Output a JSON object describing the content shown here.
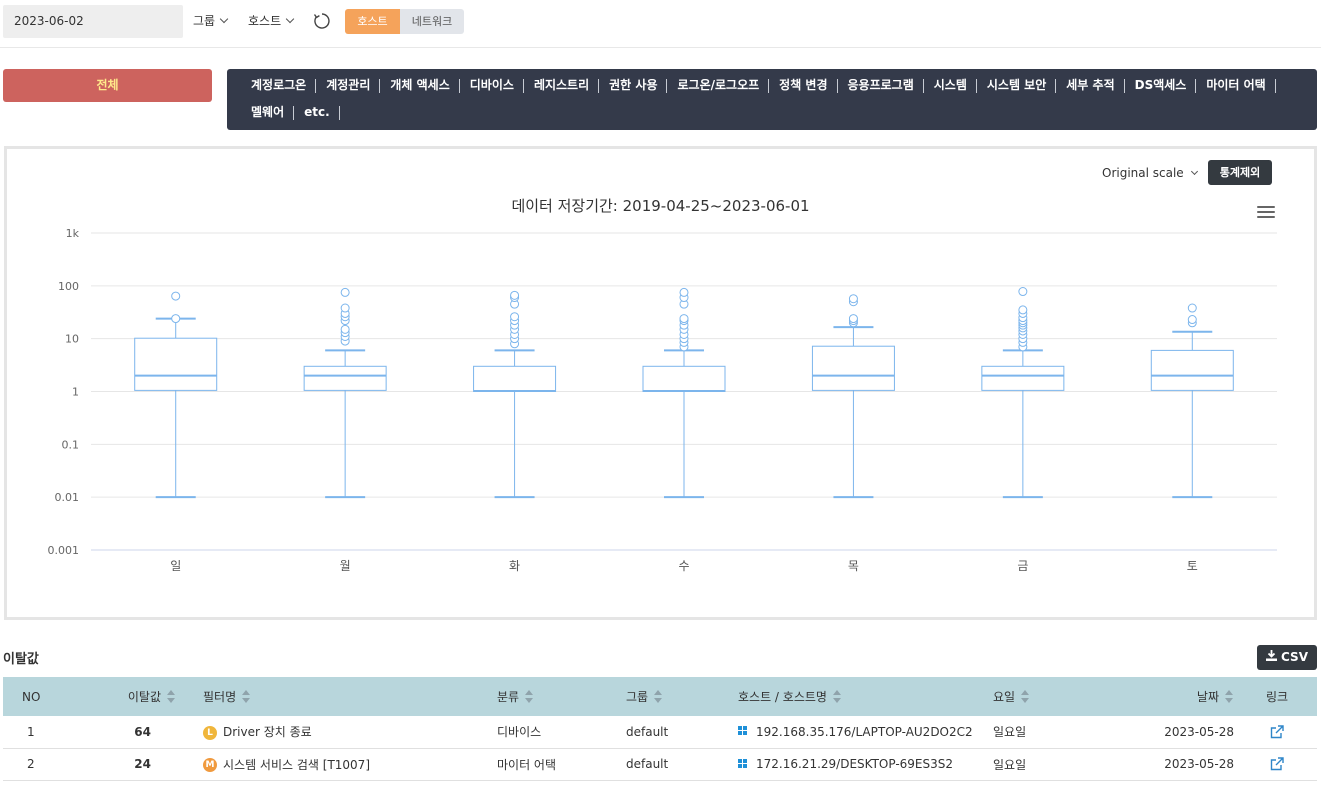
{
  "toolbar": {
    "date": "2023-06-02",
    "group_label": "그룹",
    "host_label": "호스트",
    "seg_host": "호스트",
    "seg_network": "네트워크"
  },
  "filters": {
    "all_label": "전체",
    "categories": [
      "계정로그온",
      "계정관리",
      "개체 액세스",
      "디바이스",
      "레지스트리",
      "권한 사용",
      "로그온/로그오프",
      "정책 변경",
      "응용프로그램",
      "시스템",
      "시스템 보안",
      "세부 추적",
      "DS액세스",
      "마이터 어택",
      "멜웨어",
      "etc."
    ]
  },
  "chart_controls": {
    "scale_label": "Original scale",
    "exclude_label": "통계제외",
    "title": "데이터 저장기간: 2019-04-25~2023-06-01"
  },
  "chart_data": {
    "type": "boxplot",
    "y_scale": "log",
    "ylim": [
      0.001,
      1000
    ],
    "y_ticks": [
      "0.001",
      "0.01",
      "0.1",
      "1",
      "10",
      "100",
      "1k"
    ],
    "categories": [
      "일",
      "월",
      "화",
      "수",
      "목",
      "금",
      "토"
    ],
    "boxes": [
      {
        "min": 0.01,
        "q1": 1.05,
        "median": 2,
        "q3": 10.2,
        "max": 24,
        "outliers": [
          24,
          64
        ]
      },
      {
        "min": 0.01,
        "q1": 1.05,
        "median": 2,
        "q3": 3,
        "max": 6,
        "outliers": [
          9,
          11,
          13,
          15,
          22,
          26,
          30,
          38,
          75
        ]
      },
      {
        "min": 0.01,
        "q1": 1.0,
        "median": 1.02,
        "q3": 3,
        "max": 6,
        "outliers": [
          8,
          10,
          12,
          15,
          18,
          22,
          26,
          45,
          60,
          66
        ]
      },
      {
        "min": 0.01,
        "q1": 1.0,
        "median": 1.02,
        "q3": 3,
        "max": 6,
        "outliers": [
          7,
          8.5,
          10,
          12,
          15,
          18,
          22,
          24,
          45,
          60,
          75
        ]
      },
      {
        "min": 0.01,
        "q1": 1.05,
        "median": 2,
        "q3": 7.2,
        "max": 16.5,
        "outliers": [
          20,
          22,
          24,
          50,
          57
        ]
      },
      {
        "min": 0.01,
        "q1": 1.05,
        "median": 2,
        "q3": 3,
        "max": 6,
        "outliers": [
          7,
          8.5,
          10,
          12,
          14,
          16,
          18,
          20,
          22,
          25,
          30,
          35,
          78
        ]
      },
      {
        "min": 0.01,
        "q1": 1.05,
        "median": 2,
        "q3": 6,
        "max": 13.5,
        "outliers": [
          20,
          23,
          38
        ]
      }
    ]
  },
  "outliers": {
    "title": "이탈값",
    "csv_label": "CSV",
    "headers": {
      "no": "NO",
      "value": "이탈값",
      "filter": "필터명",
      "category": "분류",
      "group": "그룹",
      "host": "호스트 / 호스트명",
      "day": "요일",
      "date": "날짜",
      "link": "링크"
    },
    "rows": [
      {
        "no": "1",
        "value": "64",
        "level": "L",
        "level_color": "#f0b63b",
        "filter": "Driver 장치 종료",
        "category": "디바이스",
        "group": "default",
        "host": "192.168.35.176/LAPTOP-AU2DO2C2",
        "day": "일요일",
        "date": "2023-05-28"
      },
      {
        "no": "2",
        "value": "24",
        "level": "M",
        "level_color": "#f09a3e",
        "filter": "시스템 서비스 검색 [T1007]",
        "category": "마이터 어택",
        "group": "default",
        "host": "172.16.21.29/DESKTOP-69ES3S2",
        "day": "일요일",
        "date": "2023-05-28"
      }
    ]
  },
  "colors": {
    "box_stroke": "#7cb5ec",
    "all_button": "#cd635e",
    "category_panel": "#343a4a",
    "seg_active": "#f5a35b",
    "table_header": "#b8d6dc"
  }
}
